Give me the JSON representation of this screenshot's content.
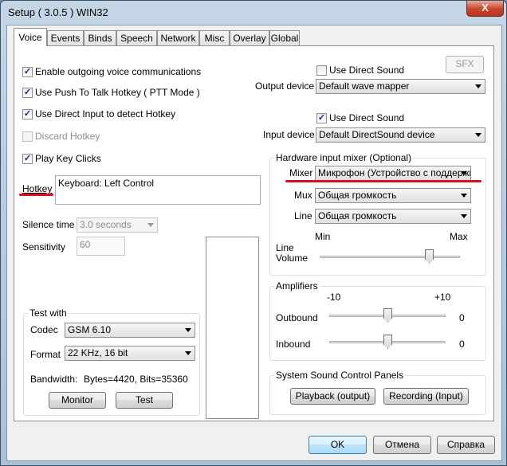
{
  "window": {
    "title": "Setup ( 3.0.5 ) WIN32",
    "close_glyph": "X"
  },
  "tabs": [
    "Voice",
    "Events",
    "Binds",
    "Speech",
    "Network",
    "Misc",
    "Overlay",
    "Global"
  ],
  "active_tab": "Voice",
  "voice": {
    "enable_outgoing": {
      "label": "Enable outgoing voice communications",
      "checked": true
    },
    "push_to_talk": {
      "label": "Use Push To Talk Hotkey ( PTT Mode )",
      "checked": true
    },
    "direct_input": {
      "label": "Use Direct Input to detect Hotkey",
      "checked": true
    },
    "discard_hotkey": {
      "label": "Discard Hotkey",
      "checked": false,
      "disabled": true
    },
    "play_key_clicks": {
      "label": "Play Key Clicks",
      "checked": true
    },
    "check_mark": "✓",
    "hotkey_label": "Hotkey",
    "hotkey_value": "Keyboard: Left Control",
    "silence_time_label": "Silence time",
    "silence_time_value": "3.0 seconds",
    "sensitivity_label": "Sensitivity",
    "sensitivity_value": "60",
    "test_with": {
      "title": "Test with",
      "codec_label": "Codec",
      "codec_value": "GSM 6.10",
      "format_label": "Format",
      "format_value": "22 KHz, 16 bit",
      "bandwidth_label": "Bandwidth:",
      "bandwidth_value": "Bytes=4420, Bits=35360",
      "monitor_button": "Monitor",
      "test_button": "Test"
    },
    "output": {
      "use_direct_sound": {
        "label": "Use Direct Sound",
        "checked": false
      },
      "sfx_button": "SFX",
      "device_label": "Output device",
      "device_value": "Default wave mapper"
    },
    "input": {
      "use_direct_sound": {
        "label": "Use Direct Sound",
        "checked": true
      },
      "device_label": "Input device",
      "device_value": "Default DirectSound device"
    },
    "hardware_mixer": {
      "title": "Hardware input mixer (Optional)",
      "mixer_label": "Mixer",
      "mixer_value": "Микрофон (Устройство с поддержкой High Definition Audio)",
      "mux_label": "Mux",
      "mux_value": "Общая громкость",
      "line_label": "Line",
      "line_value": "Общая громкость",
      "min_label": "Min",
      "max_label": "Max",
      "line_volume_label_1": "Line",
      "line_volume_label_2": "Volume",
      "line_volume_level": 0.78
    },
    "amplifiers": {
      "title": "Amplifiers",
      "min_label": "-10",
      "max_label": "+10",
      "outbound_label": "Outbound",
      "outbound_value": "0",
      "inbound_label": "Inbound",
      "inbound_value": "0"
    },
    "sound_panels": {
      "title": "System Sound Control Panels",
      "playback_button": "Playback (output)",
      "recording_button": "Recording (Input)"
    }
  },
  "footer": {
    "ok": "OK",
    "cancel": "Отмена",
    "help": "Справка"
  },
  "colors": {
    "highlight_underline": "#d8101b",
    "focus_border": "#3c7fb1"
  }
}
